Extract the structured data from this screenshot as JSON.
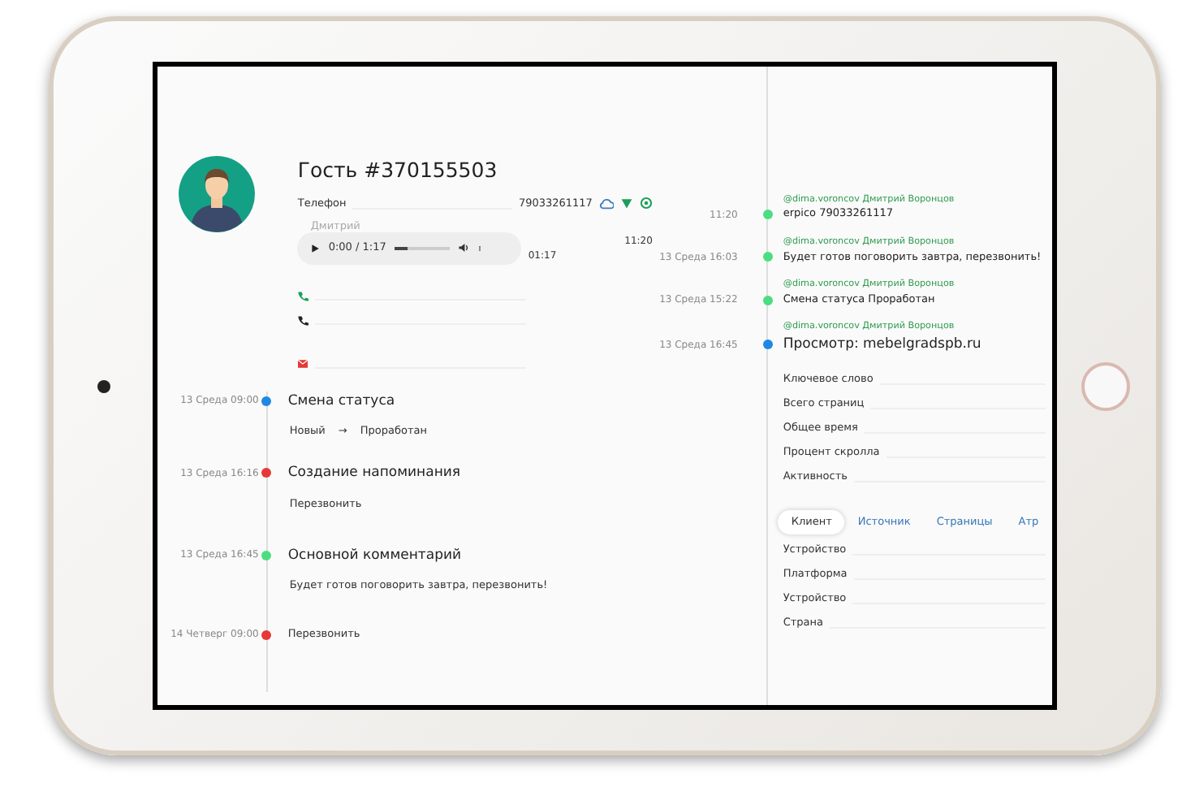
{
  "contact": {
    "name": "Гость #370155503",
    "phone_label": "Телефон",
    "phone_number": "79033261117",
    "call": {
      "caller": "Дмитрий",
      "position": "0:00 / 1:17",
      "level": 0.25,
      "duration": "01:17",
      "time": "11:20"
    },
    "lines": [
      {
        "kind": "call"
      },
      {
        "kind": "phone"
      },
      {
        "kind": "email"
      }
    ]
  },
  "history": [
    {
      "time": "13 Среда 09:00",
      "color": "#1e88e5",
      "title": "Смена статуса",
      "from": "Новый",
      "arrow": "→",
      "to": "Проработан"
    },
    {
      "time": "13 Среда 16:16",
      "color": "#e53935",
      "title": "Создание напоминания",
      "text": "Перезвонить"
    },
    {
      "time": "13 Среда 16:45",
      "color": "#4ade80",
      "title": "Основной комментарий",
      "text": "Будет готов поговорить завтра, перезвонить!"
    },
    {
      "time": "14 Четверг 09:00",
      "color": "#e53935",
      "text": "Перезвонить"
    }
  ],
  "feed": [
    {
      "kind": "message",
      "time": "11:20",
      "color": "#4ade80",
      "author": "@dima.voroncov Дмитрий Воронцов",
      "text": "erpico 79033261117"
    },
    {
      "kind": "message",
      "time": "13 Среда 16:03",
      "color": "#4ade80",
      "author": "@dima.voroncov Дмитрий Воронцов",
      "text": "Будет готов поговорить завтра, перезвонить!"
    },
    {
      "kind": "message",
      "time": "13 Среда 15:22",
      "color": "#4ade80",
      "author": "@dima.voroncov Дмитрий Воронцов",
      "text": "Смена статуса Проработан"
    },
    {
      "kind": "visit",
      "time": "13 Среда 16:45",
      "color": "#1e88e5",
      "author": "@dima.voroncov Дмитрий Воронцов",
      "text": "Просмотр: mebelgradspb.ru"
    }
  ],
  "visit_fields": [
    "Ключевое слово",
    "Всего страниц",
    "Общее время",
    "Процент скролла",
    "Активность"
  ],
  "tabs": [
    {
      "label": "Клиент",
      "selected": true
    },
    {
      "label": "Источник",
      "selected": false
    },
    {
      "label": "Страницы",
      "selected": false
    },
    {
      "label": "Атр",
      "selected": false
    }
  ],
  "client_fields": [
    "Устройство",
    "Платформа",
    "Устройство",
    "Страна"
  ]
}
